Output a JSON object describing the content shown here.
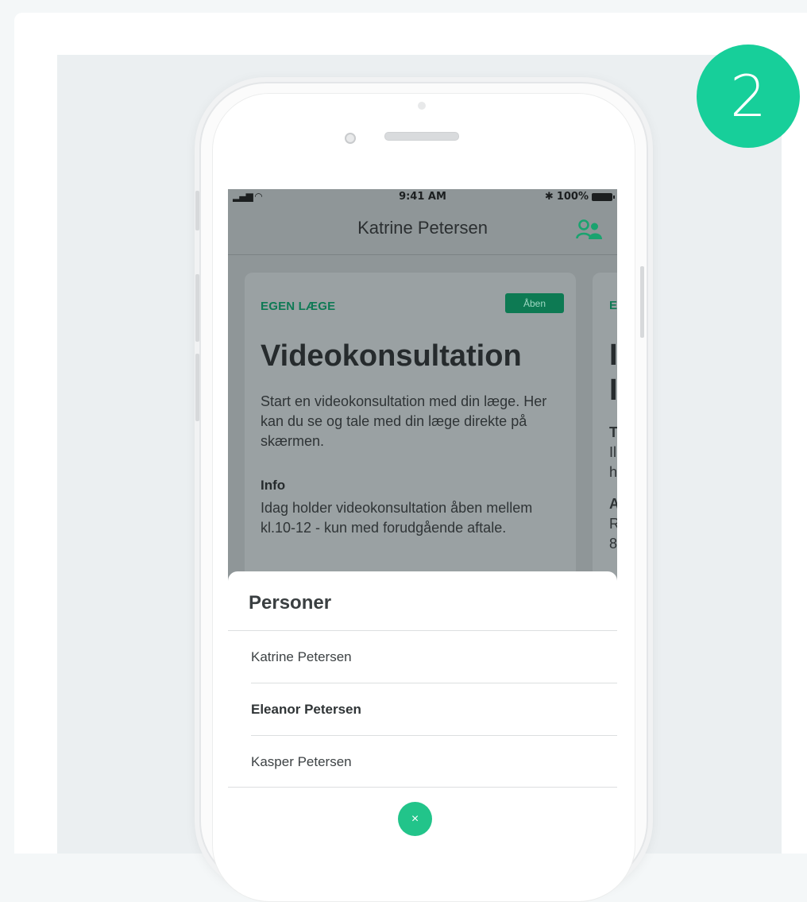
{
  "step": {
    "number": "2"
  },
  "statusbar": {
    "signal": "▂▄▆ ◠",
    "time": "9:41 AM",
    "bluetooth": "✱",
    "battery_text": "100%"
  },
  "nav": {
    "title": "Katrine Petersen",
    "icon": "persons-icon"
  },
  "card": {
    "category": "EGEN LÆGE",
    "badge": "Åben",
    "title": "Videokonsultation",
    "description": "Start en videokonsultation med din læge. Her kan du se og tale med din læge direkte på skærmen.",
    "info_heading": "Info",
    "info_text": "Idag holder videokonsultation åben mellem kl.10-12 - kun med forudgående aftale."
  },
  "next_card_peek": [
    "E",
    "I",
    "I",
    "T",
    "Il",
    "h",
    "A",
    "R",
    "8"
  ],
  "sheet": {
    "title": "Personer",
    "persons": [
      {
        "name": "Katrine Petersen",
        "selected": false
      },
      {
        "name": "Eleanor Petersen",
        "selected": true
      },
      {
        "name": "Kasper Petersen",
        "selected": false
      }
    ],
    "close_label": "×"
  },
  "colors": {
    "accent": "#17cf9a",
    "brand_green": "#0d7a53",
    "close_button": "#22c48a"
  }
}
